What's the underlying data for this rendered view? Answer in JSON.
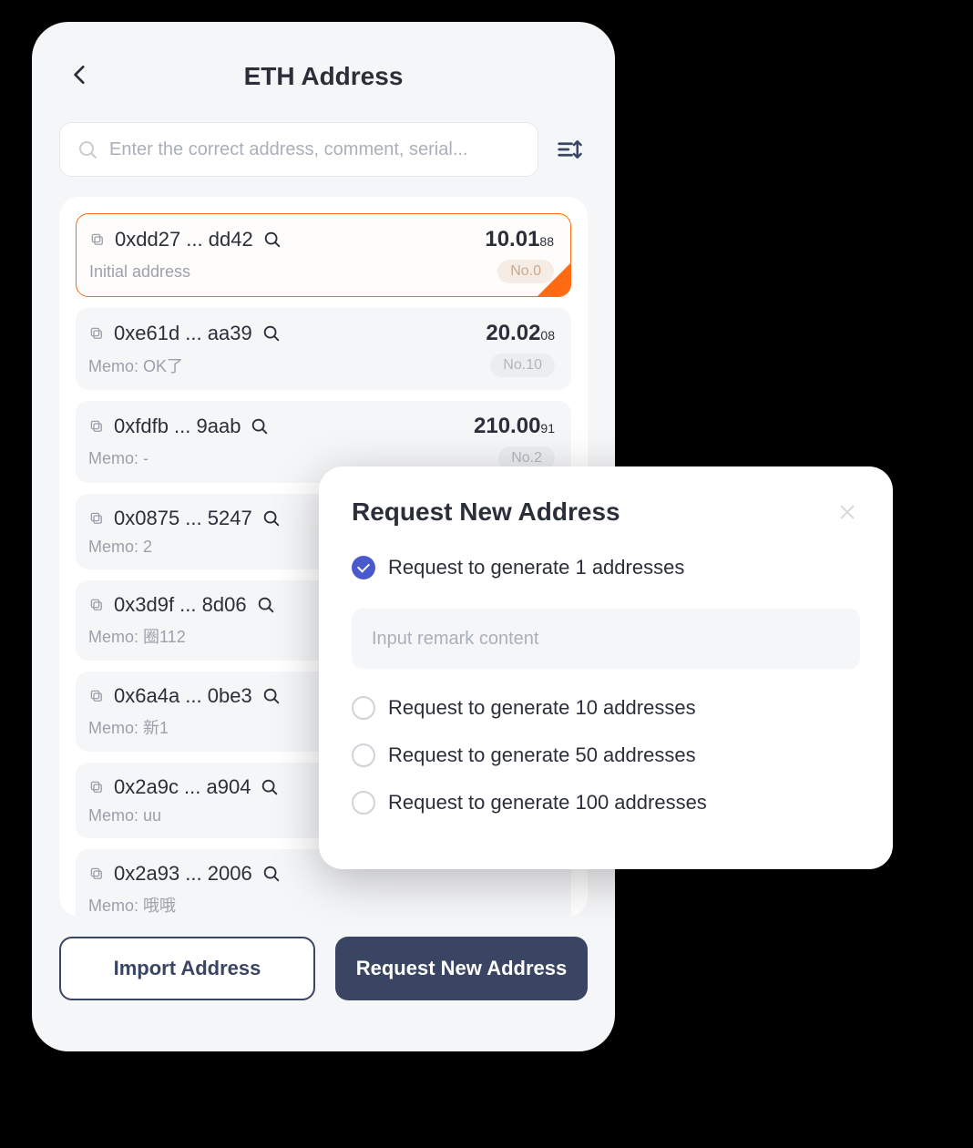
{
  "header": {
    "title": "ETH Address"
  },
  "search": {
    "placeholder": "Enter the correct address, comment, serial..."
  },
  "addresses": [
    {
      "addr": "0xdd27 ... dd42",
      "amount": "10.01",
      "amount_sub": "88",
      "memo": "Initial address",
      "no": "No.0",
      "selected": true
    },
    {
      "addr": "0xe61d ... aa39",
      "amount": "20.02",
      "amount_sub": "08",
      "memo": "Memo: OK了",
      "no": "No.10",
      "selected": false
    },
    {
      "addr": "0xfdfb ... 9aab",
      "amount": "210.00",
      "amount_sub": "91",
      "memo": "Memo: -",
      "no": "No.2",
      "selected": false
    },
    {
      "addr": "0x0875 ... 5247",
      "amount": "",
      "amount_sub": "",
      "memo": "Memo: 2",
      "no": "",
      "selected": false
    },
    {
      "addr": "0x3d9f ... 8d06",
      "amount": "",
      "amount_sub": "",
      "memo": "Memo: 圈112",
      "no": "",
      "selected": false
    },
    {
      "addr": "0x6a4a ... 0be3",
      "amount": "",
      "amount_sub": "",
      "memo": "Memo: 新1",
      "no": "",
      "selected": false
    },
    {
      "addr": "0x2a9c ... a904",
      "amount": "",
      "amount_sub": "",
      "memo": "Memo: uu",
      "no": "",
      "selected": false
    },
    {
      "addr": "0x2a93 ... 2006",
      "amount": "",
      "amount_sub": "",
      "memo": "Memo: 哦哦",
      "no": "",
      "selected": false
    }
  ],
  "footer": {
    "import_label": "Import Address",
    "request_label": "Request New Address"
  },
  "modal": {
    "title": "Request New Address",
    "remark_placeholder": "Input remark content",
    "options": [
      {
        "label": "Request to generate 1 addresses",
        "checked": true
      },
      {
        "label": "Request to generate 10 addresses",
        "checked": false
      },
      {
        "label": "Request to generate 50 addresses",
        "checked": false
      },
      {
        "label": "Request to generate 100 addresses",
        "checked": false
      }
    ]
  }
}
